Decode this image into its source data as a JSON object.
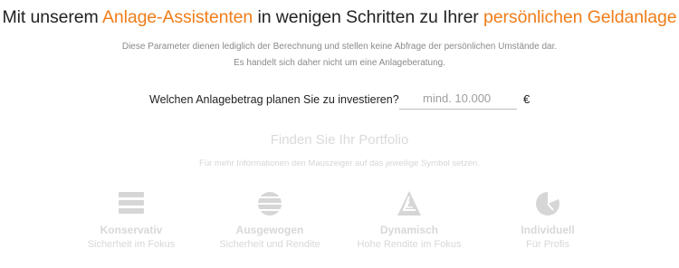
{
  "headline": {
    "part1": "Mit unserem ",
    "accent1": "Anlage-Assistenten",
    "part2": " in wenigen Schritten zu Ihrer ",
    "accent2": "persönlichen Geldanlage"
  },
  "notice": {
    "line1": "Diese Parameter dienen lediglich der Berechnung und stellen keine Abfrage der persönlichen Umstände dar.",
    "line2": "Es handelt sich daher nicht um eine Anlageberatung."
  },
  "amount": {
    "question": "Welchen Anlagebetrag planen Sie zu investieren?",
    "placeholder": "mind. 10.000",
    "value": "",
    "currency": "€"
  },
  "portfolio": {
    "title": "Finden Sie Ihr Portfolio",
    "hint": "Für mehr Informationen den Mauszeiger auf das jeweilige Symbol setzen.",
    "options": [
      {
        "name": "Konservativ",
        "desc": "Sicherheit im Fokus",
        "icon": "stacked-bars-icon"
      },
      {
        "name": "Ausgewogen",
        "desc": "Sicherheit und Rendite",
        "icon": "striped-globe-icon"
      },
      {
        "name": "Dynamisch",
        "desc": "Hohe Rendite im Fokus",
        "icon": "triangle-icon"
      },
      {
        "name": "Individuell",
        "desc": "Für Profis",
        "icon": "pie-icon"
      }
    ]
  },
  "colors": {
    "accent": "#f07d1a",
    "text": "#222222",
    "muted": "#8a8a8a",
    "inactive": "#d8d8d8"
  }
}
